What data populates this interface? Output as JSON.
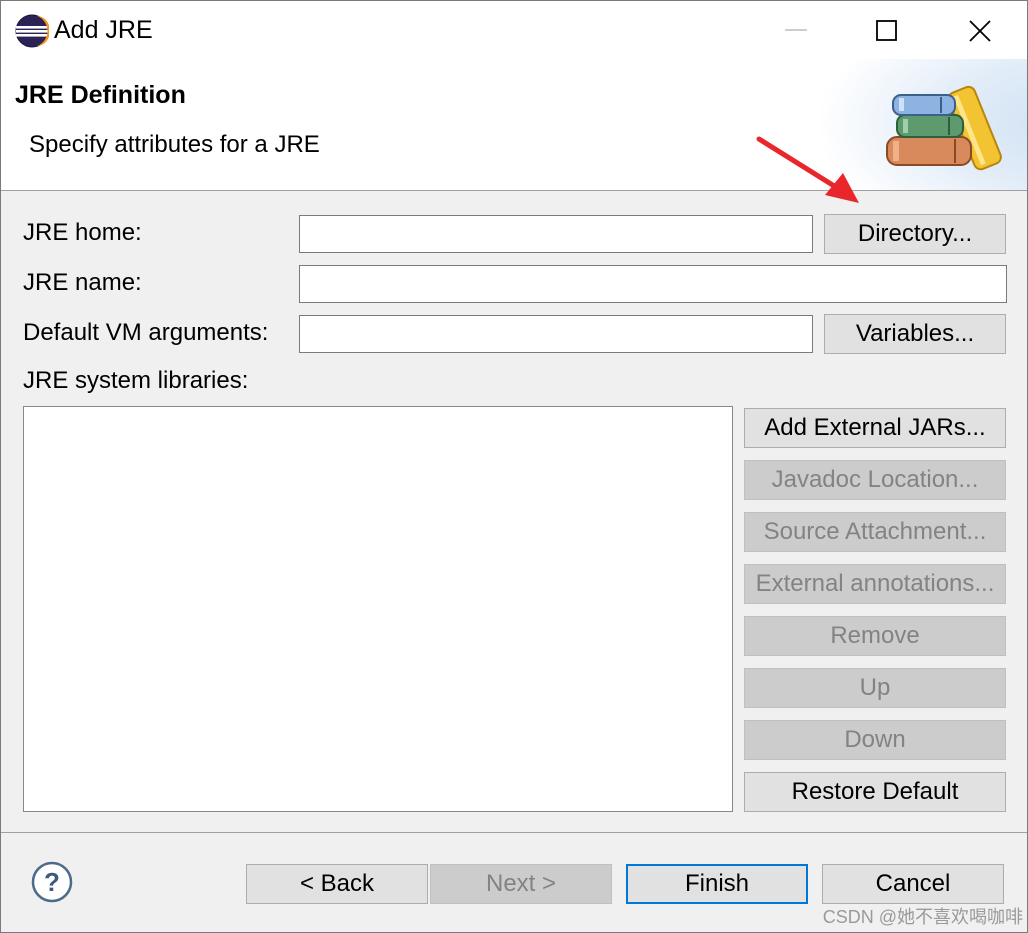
{
  "window": {
    "title": "Add JRE"
  },
  "banner": {
    "title": "JRE Definition",
    "description": "Specify attributes for a JRE",
    "icon": "books-icon"
  },
  "form": {
    "jre_home_label": "JRE home:",
    "jre_home_value": "",
    "directory_button": "Directory...",
    "jre_name_label": "JRE name:",
    "jre_name_value": "",
    "vm_args_label": "Default VM arguments:",
    "vm_args_value": "",
    "variables_button": "Variables...",
    "libraries_label": "JRE system libraries:"
  },
  "library_buttons": [
    {
      "label": "Add External JARs...",
      "enabled": true
    },
    {
      "label": "Javadoc Location...",
      "enabled": false
    },
    {
      "label": "Source Attachment...",
      "enabled": false
    },
    {
      "label": "External annotations...",
      "enabled": false
    },
    {
      "label": "Remove",
      "enabled": false
    },
    {
      "label": "Up",
      "enabled": false
    },
    {
      "label": "Down",
      "enabled": false
    },
    {
      "label": "Restore Default",
      "enabled": true
    }
  ],
  "footer": {
    "back_button": "< Back",
    "next_button": "Next >",
    "finish_button": "Finish",
    "cancel_button": "Cancel",
    "help_icon": "help-icon"
  },
  "watermark": "CSDN @她不喜欢喝咖啡",
  "colors": {
    "focus_border": "#0078d7",
    "annotation_arrow": "#e8262b"
  }
}
